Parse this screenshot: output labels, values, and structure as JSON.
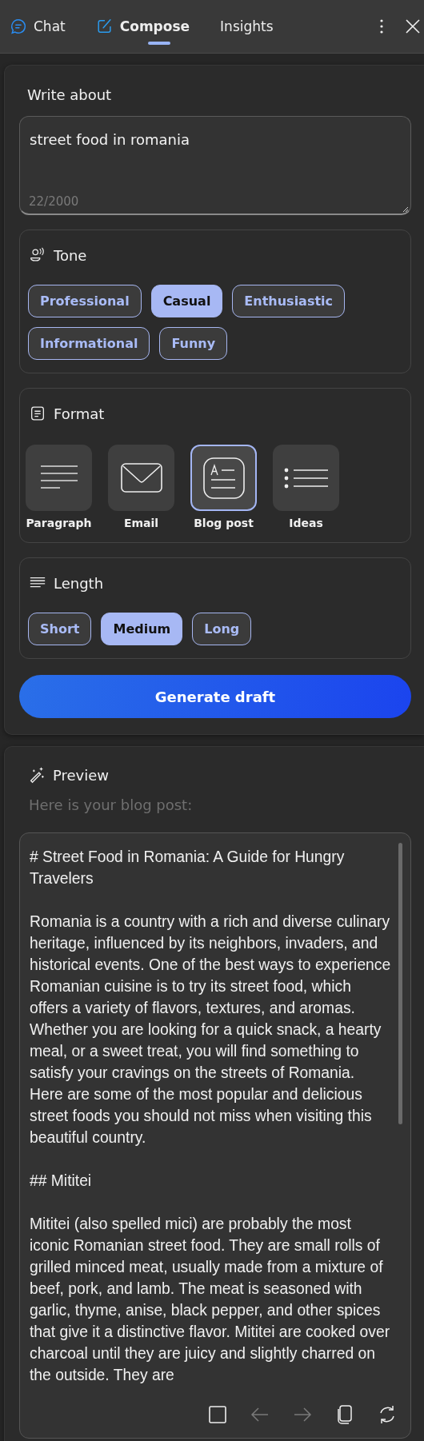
{
  "tabs": [
    {
      "label": "Chat",
      "selected": false
    },
    {
      "label": "Compose",
      "selected": true
    },
    {
      "label": "Insights",
      "selected": false
    }
  ],
  "write_about": {
    "label": "Write about",
    "value": "street food in romania",
    "counter": "22/2000"
  },
  "tone": {
    "title": "Tone",
    "options": [
      {
        "label": "Professional",
        "selected": false
      },
      {
        "label": "Casual",
        "selected": true
      },
      {
        "label": "Enthusiastic",
        "selected": false
      },
      {
        "label": "Informational",
        "selected": false
      },
      {
        "label": "Funny",
        "selected": false
      }
    ]
  },
  "format": {
    "title": "Format",
    "options": [
      {
        "label": "Paragraph",
        "selected": false
      },
      {
        "label": "Email",
        "selected": false
      },
      {
        "label": "Blog post",
        "selected": true
      },
      {
        "label": "Ideas",
        "selected": false
      }
    ]
  },
  "length": {
    "title": "Length",
    "options": [
      {
        "label": "Short",
        "selected": false
      },
      {
        "label": "Medium",
        "selected": true
      },
      {
        "label": "Long",
        "selected": false
      }
    ]
  },
  "generate_button": "Generate draft",
  "preview": {
    "title": "Preview",
    "intro": "Here is your blog post:",
    "paragraphs": [
      "# Street Food in Romania: A Guide for Hungry Travelers",
      "Romania is a country with a rich and diverse culinary heritage, influenced by its neighbors, invaders, and historical events. One of the best ways to experience Romanian cuisine is to try its street food, which offers a variety of flavors, textures, and aromas. Whether you are looking for a quick snack, a hearty meal, or a sweet treat, you will find something to satisfy your cravings on the streets of Romania. Here are some of the most popular and delicious street foods you should not miss when visiting this beautiful country.",
      "## Mititei",
      "Mititei (also spelled mici) are probably the most iconic Romanian street food. They are small rolls of grilled minced meat, usually made from a mixture of beef, pork, and lamb. The meat is seasoned with garlic, thyme, anise, black pepper, and other spices that give it a distinctive flavor. Mititei are cooked over charcoal until they are juicy and slightly charred on the outside. They are"
    ],
    "actions": [
      {
        "disabled": false
      },
      {
        "disabled": true
      },
      {
        "disabled": true
      },
      {
        "disabled": false
      },
      {
        "disabled": false
      }
    ]
  }
}
